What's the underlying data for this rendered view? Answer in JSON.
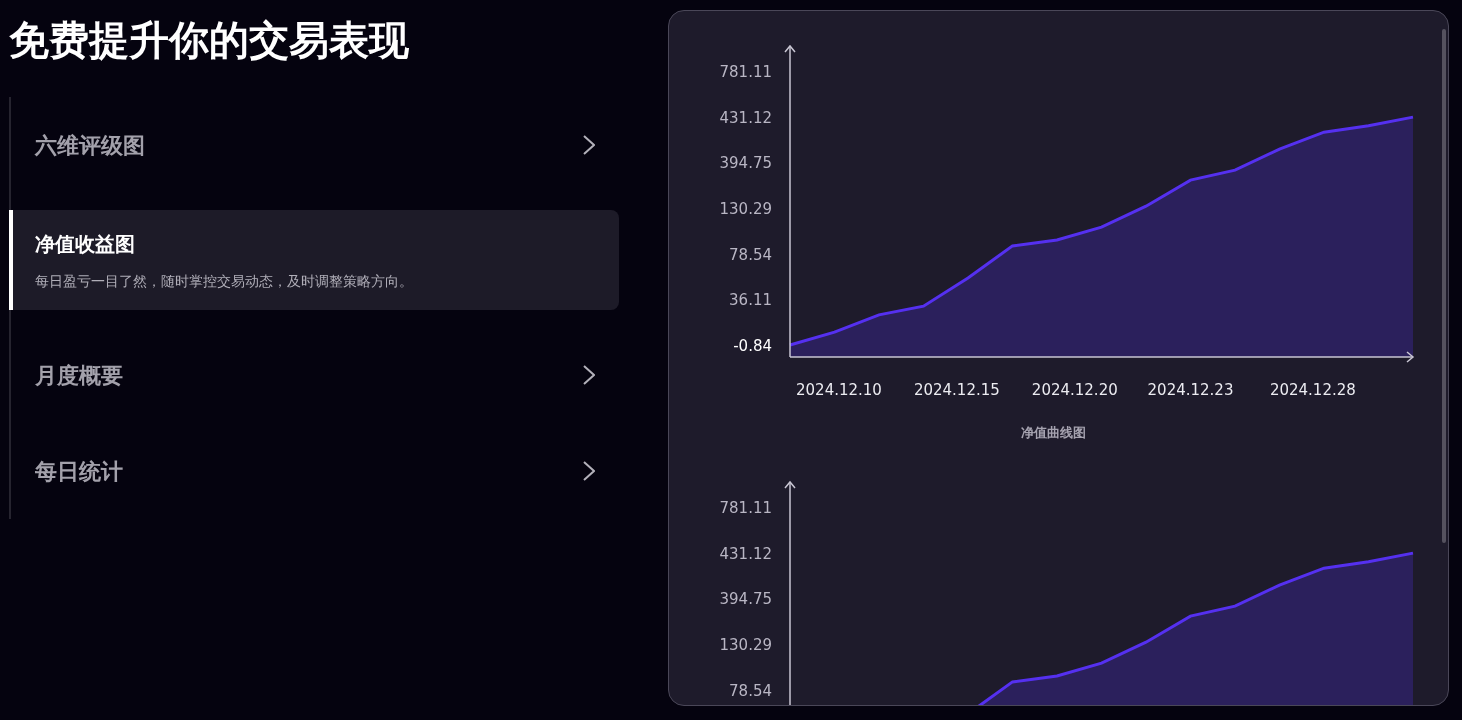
{
  "title": "免费提升你的交易表现",
  "menu": [
    {
      "label": "六维评级图",
      "selected": false
    },
    {
      "label": "净值收益图",
      "selected": true,
      "description": "每日盈亏一目了然，随时掌控交易动态，及时调整策略方向。"
    },
    {
      "label": "月度概要",
      "selected": false
    },
    {
      "label": "每日统计",
      "selected": false
    }
  ],
  "charts": [
    {
      "y_tick_labels": [
        "781.11",
        "431.12",
        "394.75",
        "130.29",
        "78.54",
        "36.11",
        "-0.84"
      ],
      "x_tick_labels": [
        "2024.12.10",
        "2024.12.15",
        "2024.12.20",
        "2024.12.23",
        "2024.12.28"
      ],
      "caption": "净值曲线图"
    },
    {
      "y_tick_labels": [
        "781.11",
        "431.12",
        "394.75",
        "130.29",
        "78.54"
      ]
    }
  ]
}
